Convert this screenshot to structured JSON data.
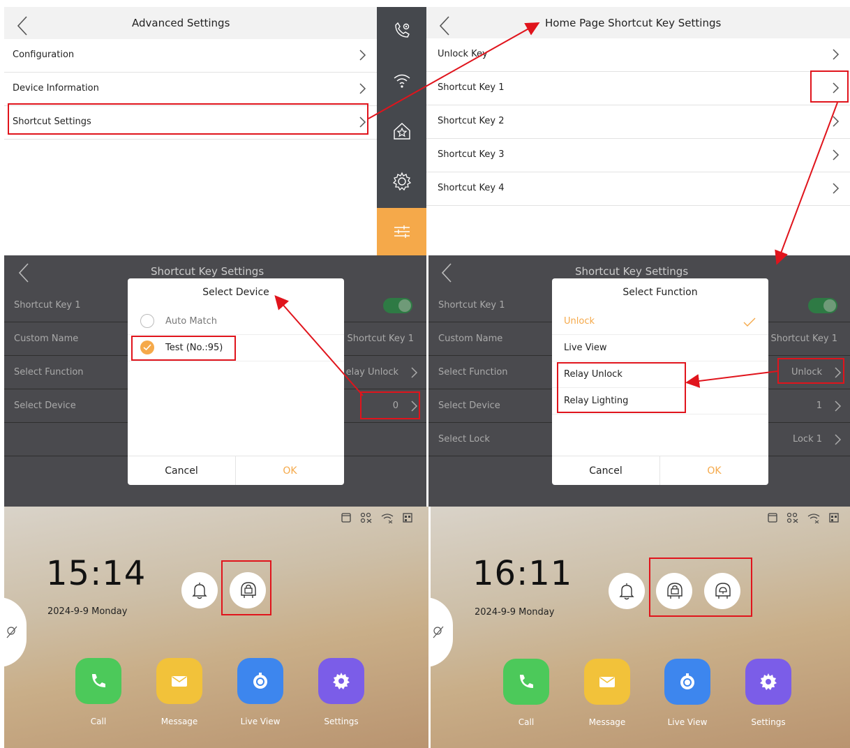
{
  "advanced_settings": {
    "title": "Advanced Settings",
    "items": [
      {
        "label": "Configuration"
      },
      {
        "label": "Device Information"
      },
      {
        "label": "Shortcut Settings"
      }
    ]
  },
  "home_shortcut": {
    "title": "Home Page Shortcut Key Settings",
    "items": [
      {
        "label": "Unlock Key"
      },
      {
        "label": "Shortcut Key 1"
      },
      {
        "label": "Shortcut Key 2"
      },
      {
        "label": "Shortcut Key 3"
      },
      {
        "label": "Shortcut Key 4"
      }
    ]
  },
  "sidebar": {
    "items": [
      {
        "icon": "phone-settings-icon"
      },
      {
        "icon": "wifi-icon"
      },
      {
        "icon": "home-star-icon"
      },
      {
        "icon": "gear-icon"
      },
      {
        "icon": "sliders-icon",
        "active": true
      }
    ],
    "active_color": "#f5a94a"
  },
  "shortcut_left": {
    "title": "Shortcut Key Settings",
    "rows": [
      {
        "label": "Shortcut Key 1",
        "value": ""
      },
      {
        "label": "Custom Name",
        "value": "Shortcut Key 1"
      },
      {
        "label": "Select Function",
        "value": "elay Unlock"
      },
      {
        "label": "Select Device",
        "value": "0"
      }
    ],
    "dialog": {
      "title": "Select Device",
      "options": [
        {
          "label": "Auto Match",
          "selected": false
        },
        {
          "label": "Test (No.:95)",
          "selected": true
        }
      ],
      "cancel": "Cancel",
      "ok": "OK"
    }
  },
  "shortcut_right": {
    "title": "Shortcut Key Settings",
    "rows": [
      {
        "label": "Shortcut Key 1",
        "value": ""
      },
      {
        "label": "Custom Name",
        "value": "Shortcut Key 1"
      },
      {
        "label": "Select Function",
        "value": "Unlock"
      },
      {
        "label": "Select Device",
        "value": "1"
      },
      {
        "label": "Select Lock",
        "value": "Lock 1"
      }
    ],
    "dialog": {
      "title": "Select Function",
      "options": [
        {
          "label": "Unlock",
          "selected": true
        },
        {
          "label": "Live View",
          "selected": false
        },
        {
          "label": "Relay Unlock",
          "selected": false
        },
        {
          "label": "Relay Lighting",
          "selected": false
        }
      ],
      "cancel": "Cancel",
      "ok": "OK"
    }
  },
  "home_left": {
    "time": "15:14",
    "date": "2024-9-9  Monday",
    "apps": [
      {
        "label": "Call",
        "color": "#4cc95a"
      },
      {
        "label": "Message",
        "color": "#f2c23a"
      },
      {
        "label": "Live View",
        "color": "#3d86ee"
      },
      {
        "label": "Settings",
        "color": "#7b5de8"
      }
    ]
  },
  "home_right": {
    "time": "16:11",
    "date": "2024-9-9  Monday",
    "apps": [
      {
        "label": "Call",
        "color": "#4cc95a"
      },
      {
        "label": "Message",
        "color": "#f2c23a"
      },
      {
        "label": "Live View",
        "color": "#3d86ee"
      },
      {
        "label": "Settings",
        "color": "#7b5de8"
      }
    ]
  },
  "colors": {
    "highlight_red": "#e0141c",
    "accent_orange": "#f5a94a",
    "toggle_green": "#2e7a44"
  }
}
